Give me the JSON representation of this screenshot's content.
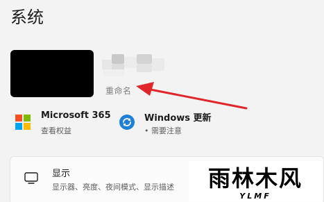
{
  "page_title": "系统",
  "device": {
    "rename_label": "重命名"
  },
  "tiles": [
    {
      "title": "Microsoft 365",
      "subtitle": "查看权益",
      "icon": "microsoft-logo-icon"
    },
    {
      "title": "Windows 更新",
      "subtitle": "• 需要注意",
      "icon": "sync-icon"
    }
  ],
  "settings_list": [
    {
      "title": "显示",
      "subtitle": "显示器、亮度、夜间模式、显示描述",
      "icon": "monitor-icon"
    }
  ],
  "watermark": {
    "text": "雨林木风",
    "subtext": "YLMF"
  },
  "colors": {
    "accent_red": "#e0262b",
    "ms_red": "#f25022",
    "ms_green": "#7fba00",
    "ms_blue": "#00a4ef",
    "ms_yellow": "#ffb900",
    "update_blue": "#1e7fd6"
  }
}
